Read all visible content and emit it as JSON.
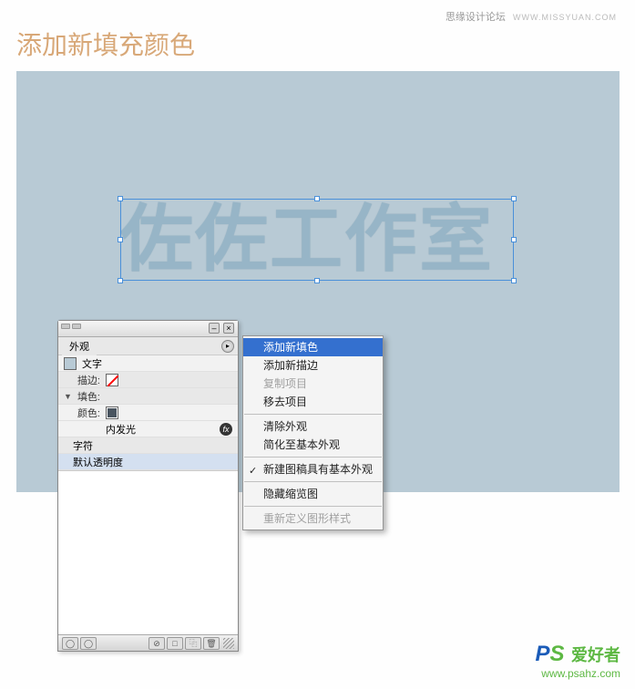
{
  "watermark": {
    "forum": "思缘设计论坛",
    "site": "WWW.MISSYUAN.COM"
  },
  "title": "添加新填充颜色",
  "canvas_text": "佐佐工作室",
  "panel": {
    "title": "外观",
    "type_label": "文字",
    "stroke_label": "描边:",
    "fill_label": "填色:",
    "color_label": "颜色:",
    "inner_glow": "内发光",
    "characters": "字符",
    "default_opacity": "默认透明度"
  },
  "menu": {
    "add_fill": "添加新填色",
    "add_stroke": "添加新描边",
    "duplicate": "复制项目",
    "remove": "移去项目",
    "clear": "清除外观",
    "reduce": "简化至基本外观",
    "new_art": "新建图稿具有基本外观",
    "hide_thumb": "隐藏缩览图",
    "redefine": "重新定义图形样式"
  },
  "footer": {
    "brand_cn": "爱好者",
    "url": "www.psahz.com"
  }
}
